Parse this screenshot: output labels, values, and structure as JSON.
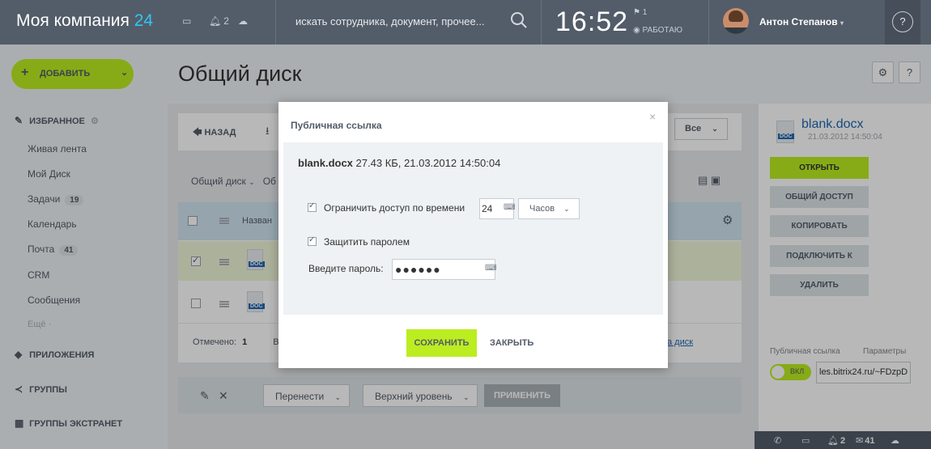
{
  "topbar": {
    "brand": "Моя компания",
    "brand_num": "24",
    "notif_count": "2",
    "search_placeholder": "искать сотрудника, документ, прочее...",
    "clock": "16:52",
    "flag_count": "1",
    "work_status": "РАБОТАЮ",
    "user_name": "Антон Степанов",
    "help": "?"
  },
  "sidebar": {
    "add_label": "ДОБАВИТЬ",
    "favorites": "ИЗБРАННОЕ",
    "items": [
      {
        "label": "Живая лента"
      },
      {
        "label": "Мой Диск"
      },
      {
        "label": "Задачи",
        "badge": "19"
      },
      {
        "label": "Календарь"
      },
      {
        "label": "Почта",
        "badge": "41"
      },
      {
        "label": "CRM"
      },
      {
        "label": "Сообщения"
      },
      {
        "label": "Ещё"
      }
    ],
    "apps": "ПРИЛОЖЕНИЯ",
    "groups": "ГРУППЫ",
    "extranet": "ГРУППЫ ЭКСТРАНЕТ"
  },
  "main": {
    "title": "Общий диск",
    "back": "НАЗАД",
    "select_all": "Все",
    "crumb1": "Общий диск",
    "crumb2": "Об",
    "col_name": "Назван",
    "marked_label": "Отмечено:",
    "marked_count": "1",
    "footer_b": "В",
    "disk_link": "а диск",
    "move": "Перенести",
    "top_level": "Верхний уровень",
    "apply": "ПРИМЕНИТЬ"
  },
  "right": {
    "file_name": "blank.docx",
    "file_date": "21.03.2012 14:50:04",
    "buttons": [
      "ОТКРЫТЬ",
      "ОБЩИЙ ДОСТУП",
      "КОПИРОВАТЬ",
      "ПОДКЛЮЧИТЬ К",
      "УДАЛИТЬ"
    ],
    "public_link_label": "Публичная ссылка",
    "params_label": "Параметры",
    "toggle_label": "ВКЛ",
    "link_value": "les.bitrix24.ru/~FDzpD",
    "bottom_notif": "2",
    "bottom_mail": "41"
  },
  "modal": {
    "title": "Публичная ссылка",
    "close": "×",
    "file_name": "blank.docx",
    "file_meta": "27.43 КБ, 21.03.2012 14:50:04",
    "limit_time_label": "Ограничить доступ по времени",
    "time_value": "24",
    "time_unit": "Часов",
    "protect_label": "Защитить паролем",
    "password_label": "Введите пароль:",
    "password_value": "●●●●●●",
    "save": "СОХРАНИТЬ",
    "cancel": "ЗАКРЫТЬ"
  },
  "colors": {
    "accent_green": "#bbed21",
    "header_bg": "#535c69",
    "link_blue": "#2067b0"
  }
}
